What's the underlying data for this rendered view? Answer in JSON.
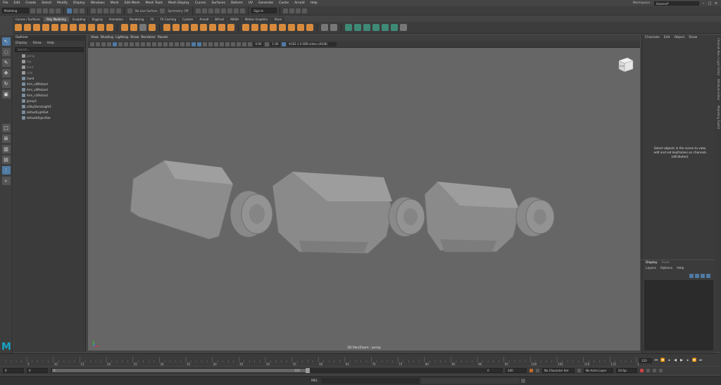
{
  "menubar": {
    "items": [
      "File",
      "Edit",
      "Create",
      "Select",
      "Modify",
      "Display",
      "Windows",
      "Mesh",
      "Edit Mesh",
      "Mesh Tools",
      "Mesh Display",
      "Curves",
      "Surfaces",
      "Deform",
      "UV",
      "Generate",
      "Cache",
      "Arnold",
      "Help"
    ],
    "workspace_label": "Workspace :",
    "workspace_value": "General*"
  },
  "statusline": {
    "mode": "Modeling",
    "live_surface": "No Live Surface",
    "symmetry": "Symmetry: Off",
    "sign_in": "Sign In"
  },
  "shelf": {
    "tabs": [
      "Curves / Surfaces",
      "Poly Modeling",
      "Sculpting",
      "Rigging",
      "Animation",
      "Rendering",
      "FX",
      "FX Caching",
      "Custom",
      "Arnold",
      "Bifrost",
      "MASH",
      "Motion Graphics",
      "XGen"
    ],
    "active_tab": 1
  },
  "outliner": {
    "title": "Outliner",
    "menu": [
      "Display",
      "Show",
      "Help"
    ],
    "search_placeholder": "Search...",
    "items": [
      {
        "label": "persp",
        "dim": true,
        "icon": "camera-icon"
      },
      {
        "label": "top",
        "dim": true,
        "icon": "camera-icon"
      },
      {
        "label": "front",
        "dim": true,
        "icon": "camera-icon"
      },
      {
        "label": "side",
        "dim": true,
        "icon": "camera-icon"
      },
      {
        "label": "hand",
        "dim": false,
        "icon": "mesh-icon"
      },
      {
        "label": "Arm_v0Mstand",
        "dim": false,
        "icon": "mesh-icon"
      },
      {
        "label": "Arm_v0Mstand",
        "dim": false,
        "icon": "mesh-icon"
      },
      {
        "label": "Arm_v1Mstand",
        "dim": false,
        "icon": "mesh-icon"
      },
      {
        "label": "group1",
        "dim": false,
        "icon": "group-icon"
      },
      {
        "label": "aiSkyDomeLight1",
        "dim": false,
        "icon": "light-icon"
      },
      {
        "label": "defaultLightSet",
        "dim": false,
        "icon": "set-icon"
      },
      {
        "label": "defaultObjectSet",
        "dim": false,
        "icon": "set-icon"
      }
    ]
  },
  "viewport": {
    "menu": [
      "View",
      "Shading",
      "Lighting",
      "Show",
      "Renderer",
      "Panels"
    ],
    "near_value": "0.00",
    "far_value": "1.00",
    "color_space": "ACES 1.0 SDR-video (sRGB)",
    "panel_label": "2D Pan/Zoom : persp",
    "viewcube_label": "FRONT"
  },
  "channel_box": {
    "menu": [
      "Channels",
      "Edit",
      "Object",
      "Show"
    ],
    "message": "Select objects in the scene to view, edit and set keyframes on channels (attributes)."
  },
  "layer_editor": {
    "tabs": [
      "Display",
      "Anim"
    ],
    "menu": [
      "Layers",
      "Options",
      "Help"
    ]
  },
  "side_tabs": [
    "Channel Box / Layer Editor",
    "Attribute Editor",
    "Modelling Toolkit"
  ],
  "timeline": {
    "current_frame": "120",
    "tick_labels": [
      "5",
      "10",
      "15",
      "20",
      "25",
      "30",
      "35",
      "40",
      "45",
      "50",
      "55",
      "60",
      "65",
      "70",
      "75",
      "80",
      "85",
      "90",
      "95",
      "100",
      "105",
      "110",
      "115",
      "120"
    ]
  },
  "range": {
    "start": "0",
    "playback_start": "0",
    "slider_start": "0",
    "slider_end": "120",
    "playback_end": "120",
    "end": "200",
    "character_set": "No Character Set",
    "anim_layer": "No Anim Layer",
    "fps": "24 fps"
  },
  "command_line": {
    "language": "MEL"
  },
  "colors": {
    "viewport_bg": "#666666",
    "accent": "#4f7aa3",
    "shelf_orange": "#d78a3c",
    "maya_logo": "#18a3c6"
  }
}
